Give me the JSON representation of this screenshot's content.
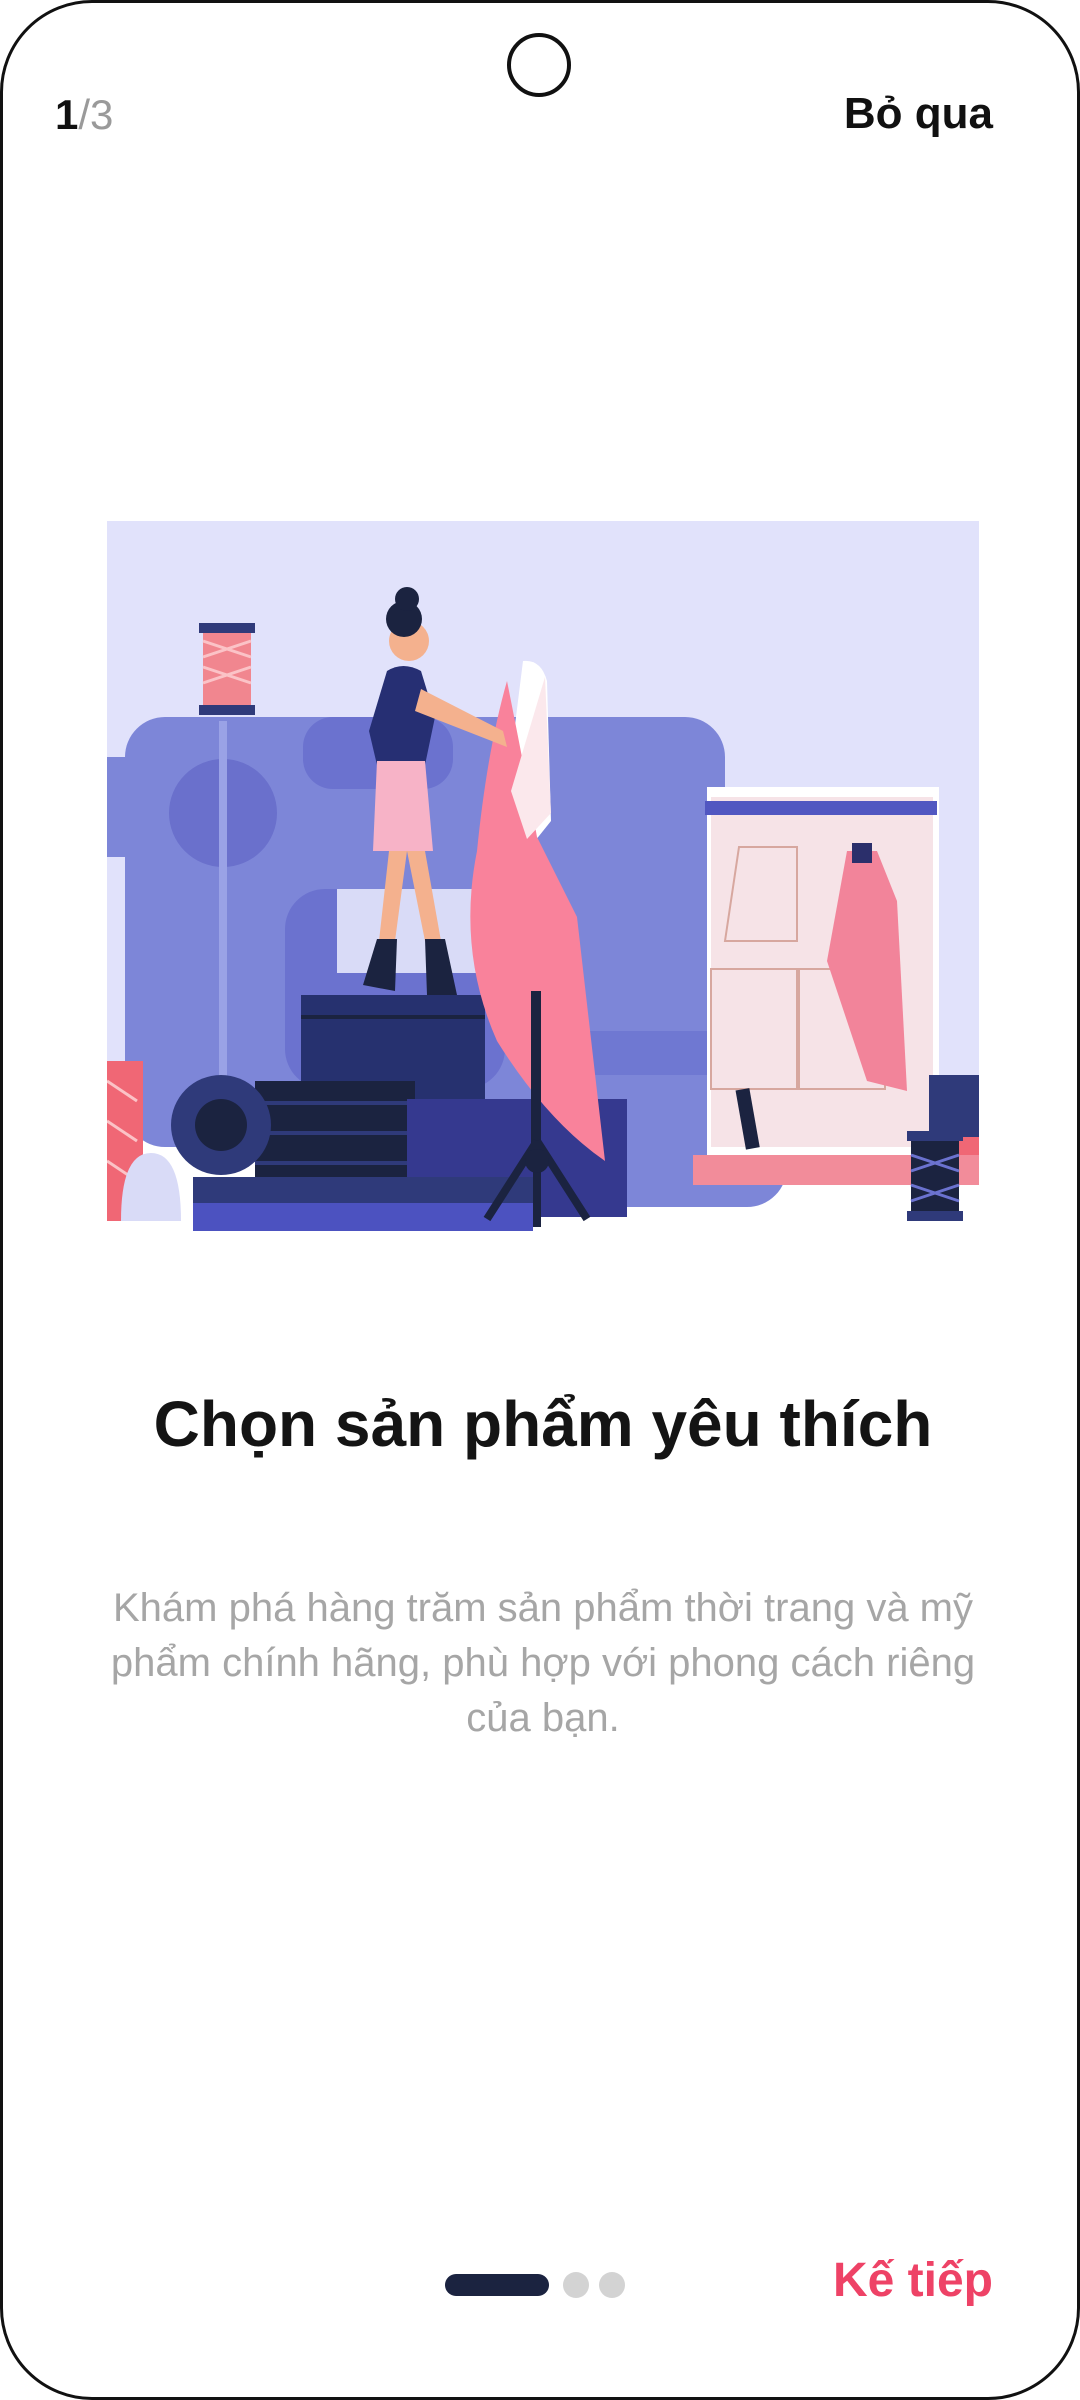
{
  "header": {
    "page_current": "1",
    "page_total": "/3",
    "skip_label": "Bỏ qua"
  },
  "onboarding": {
    "title": "Chọn sản phẩm yêu thích",
    "description": "Khám phá hàng trăm sản phẩm thời trang và mỹ phẩm chính hãng, phù hợp với phong cách riêng của bạn.",
    "illustration_icon": "fashion-designer-sewing-illustration"
  },
  "footer": {
    "pages": 3,
    "active_index": 0,
    "next_label": "Kế tiếp"
  },
  "colors": {
    "accent": "#ee4266",
    "dot_active": "#1b2340",
    "dot_inactive": "#d3d3d3",
    "title": "#141414",
    "description": "#a6a6a6"
  }
}
